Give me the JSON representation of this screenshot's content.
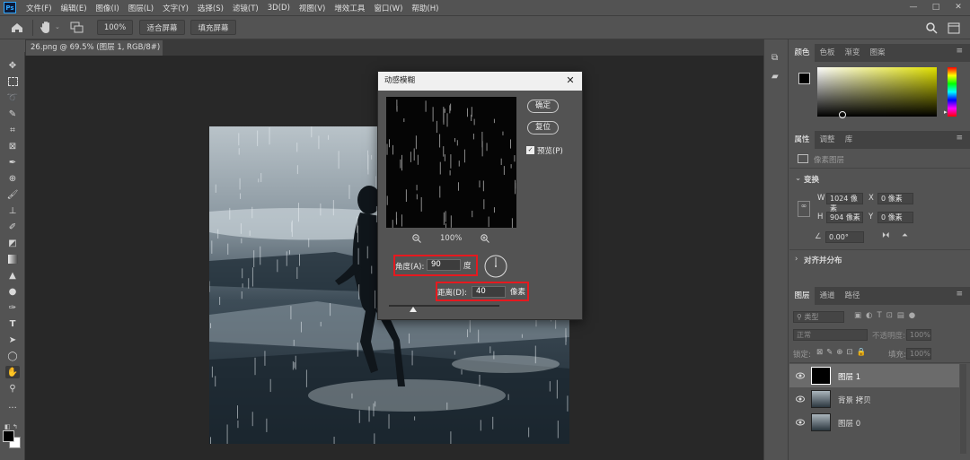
{
  "app": {
    "logo": "Ps"
  },
  "menu": [
    "文件(F)",
    "编辑(E)",
    "图像(I)",
    "图层(L)",
    "文字(Y)",
    "选择(S)",
    "滤镜(T)",
    "3D(D)",
    "视图(V)",
    "增效工具",
    "窗口(W)",
    "帮助(H)"
  ],
  "window_controls": {
    "minimize": "—",
    "restore": "□",
    "close": "✕"
  },
  "options": {
    "zoom": "100%",
    "fit_screen": "适合屏幕",
    "fill_screen": "填充屏幕"
  },
  "document": {
    "tab_title": "26.png @ 69.5% (图层 1, RGB/8#) *",
    "tab_close": "×"
  },
  "dialog": {
    "title": "动感模糊",
    "close": "✕",
    "ok_label": "确定",
    "reset_label": "复位",
    "preview_label": "预览(P)",
    "preview_checked": true,
    "zoom": "100%",
    "angle_label": "角度(A):",
    "angle_value": "90",
    "angle_unit": "度",
    "distance_label": "距离(D):",
    "distance_value": "40",
    "distance_unit": "像素"
  },
  "panels": {
    "color_tabs": [
      "颜色",
      "色板",
      "渐变",
      "图案"
    ],
    "props_tabs": [
      "属性",
      "调整",
      "库"
    ],
    "pixel_layer_label": "像素图层",
    "transform_label": "变换",
    "w_label": "W",
    "w_value": "1024 像素",
    "h_label": "H",
    "h_value": "904 像素",
    "x_label": "X",
    "x_value": "0 像素",
    "y_label": "Y",
    "y_value": "0 像素",
    "angle_value": "0.00°",
    "align_label": "对齐并分布",
    "layers_tabs": [
      "图层",
      "通道",
      "路径"
    ],
    "filter_kind": "类型",
    "blend_mode": "正常",
    "opacity_label": "不透明度:",
    "opacity_value": "100%",
    "lock_label": "锁定:",
    "fill_label": "填充:",
    "fill_value": "100%",
    "layers": [
      {
        "name": "图层 1",
        "selected": true
      },
      {
        "name": "背景 拷贝",
        "selected": false
      },
      {
        "name": "图层 0",
        "selected": false
      }
    ]
  },
  "colors": {
    "accent_red": "#e6191f",
    "ps_blue": "#31a8ff",
    "fg_swatch": "#000000",
    "bg_swatch": "#ffffff"
  }
}
